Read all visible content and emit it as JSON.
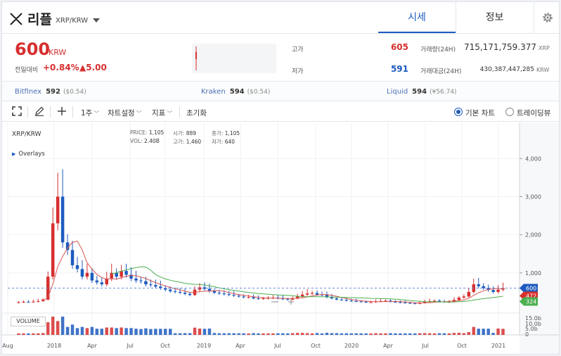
{
  "header": {
    "coin_name": "리플",
    "pair": "XRP/KRW",
    "tabs": [
      {
        "label": "시세",
        "active": true
      },
      {
        "label": "정보",
        "active": false
      }
    ]
  },
  "summary": {
    "price": "600",
    "unit": "KRW",
    "change_label": "전일대비",
    "change_rate": "+0.84%",
    "change_amount": "▲5.00",
    "high_label": "고가",
    "high_value": "605",
    "low_label": "저가",
    "low_value": "591",
    "volume_label": "거래량(24H)",
    "volume_value": "715,171,759.377",
    "volume_unit": "XRP",
    "amount_label": "거래대금(24H)",
    "amount_value": "430,387,447,285",
    "amount_unit": "KRW"
  },
  "exchanges": [
    {
      "name": "Bitfinex",
      "price": "592",
      "usd": "($0.54)"
    },
    {
      "name": "Kraken",
      "price": "594",
      "usd": "($0.54)"
    },
    {
      "name": "Liquid",
      "price": "594",
      "usd": "(¥56.74)"
    }
  ],
  "toolbar": {
    "period": "1주",
    "chart_settings": "차트설정",
    "indicators": "지표",
    "reset": "초기화",
    "basic_chart": "기본 차트",
    "tradingview": "트레이딩뷰"
  },
  "chart_info": {
    "pair": "XRP/KRW",
    "overlays": "Overlays",
    "price_label": "PRICE:",
    "price": "1,105",
    "vol_label": "VOL:",
    "vol": "2.40B",
    "open_label": "시가:",
    "open": "889",
    "high_label": "고가:",
    "high": "1,460",
    "close_label": "종가:",
    "close": "1,105",
    "low_label": "저가:",
    "low": "640",
    "volume_button": "VOLUME"
  },
  "colors": {
    "up": "#d62f2f",
    "down": "#1d5bbf",
    "ma_short": "#d9534f",
    "ma_long": "#4caf50",
    "accent": "#1d5bbf"
  },
  "chart_data": {
    "type": "candlestick",
    "y_ticks": [
      "4,000",
      "3,000",
      "2,000",
      "1,000"
    ],
    "y_range": [
      0,
      4800
    ],
    "volume_ticks": [
      "15.0b",
      "10.0b",
      "5.0b",
      "0"
    ],
    "x_labels": [
      "Aug",
      "2018",
      "Apr",
      "Jul",
      "Oct",
      "2019",
      "Apr",
      "Jul",
      "Oct",
      "2020",
      "Apr",
      "Jul",
      "Oct",
      "2021"
    ],
    "current_price_tag": "600",
    "ma_tags": [
      "472",
      "324"
    ],
    "weekly_close": [
      230,
      240,
      235,
      245,
      260,
      300,
      900,
      2300,
      3000,
      1800,
      1600,
      1200,
      1100,
      900,
      1000,
      800,
      750,
      700,
      850,
      1000,
      900,
      1050,
      950,
      850,
      800,
      780,
      700,
      680,
      640,
      600,
      560,
      520,
      500,
      480,
      450,
      420,
      560,
      620,
      580,
      520,
      480,
      460,
      440,
      420,
      400,
      380,
      360,
      360,
      330,
      320,
      330,
      340,
      350,
      330,
      310,
      300,
      330,
      380,
      430,
      460,
      470,
      430,
      420,
      360,
      330,
      300,
      290,
      270,
      260,
      250,
      240,
      230,
      230,
      250,
      260,
      270,
      240,
      230,
      220,
      210,
      200,
      190,
      210,
      240,
      260,
      270,
      250,
      230,
      240,
      290,
      350,
      380,
      500,
      700,
      650,
      600,
      550,
      500,
      560,
      600
    ]
  }
}
